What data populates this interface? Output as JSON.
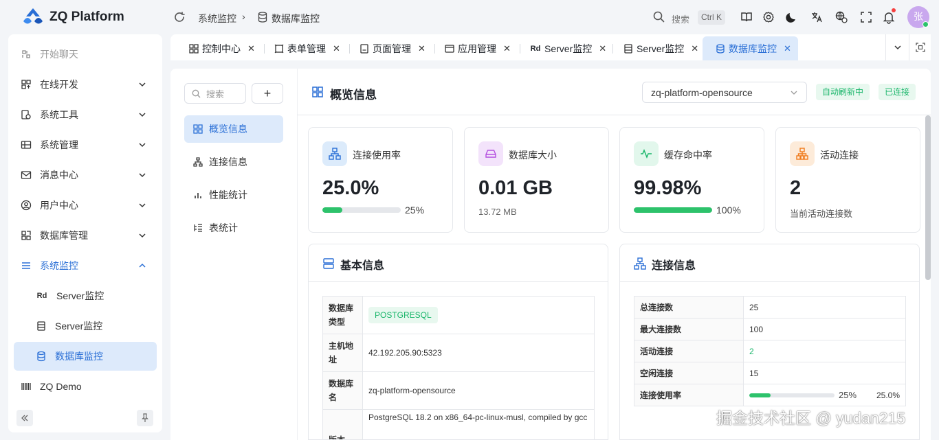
{
  "app": {
    "title": "ZQ Platform",
    "brand_color": "#2a6fd6"
  },
  "breadcrumb": {
    "parent": "系统监控",
    "current": "数据库监控"
  },
  "header": {
    "search_label": "搜索",
    "search_shortcut": "Ctrl K",
    "avatar_text": "张",
    "icons": [
      "book-icon",
      "settings-icon",
      "dark-mode-icon",
      "translate-icon",
      "language-icon",
      "fullscreen-icon",
      "bell-icon"
    ]
  },
  "sidebar": {
    "items": [
      {
        "label": "开始聊天",
        "icon": "chat-icon"
      },
      {
        "label": "在线开发",
        "icon": "dev-icon"
      },
      {
        "label": "系统工具",
        "icon": "tools-icon"
      },
      {
        "label": "系统管理",
        "icon": "manage-icon"
      },
      {
        "label": "消息中心",
        "icon": "mail-icon"
      },
      {
        "label": "用户中心",
        "icon": "user-icon"
      },
      {
        "label": "数据库管理",
        "icon": "db-manage-icon"
      },
      {
        "label": "系统监控",
        "icon": "monitor-icon"
      }
    ],
    "sub_items": [
      {
        "label": "Server监控",
        "prefix": "Rd"
      },
      {
        "label": "Server监控"
      },
      {
        "label": "数据库监控"
      }
    ],
    "demo": "ZQ Demo"
  },
  "tabs": [
    {
      "label": "控制中心"
    },
    {
      "label": "表单管理"
    },
    {
      "label": "页面管理"
    },
    {
      "label": "应用管理"
    },
    {
      "label": "Server监控",
      "prefix": "Rd"
    },
    {
      "label": "Server监控"
    },
    {
      "label": "数据库监控"
    }
  ],
  "db_menu": {
    "search_placeholder": "搜索",
    "add_label": "+",
    "items": [
      "概览信息",
      "连接信息",
      "性能统计",
      "表统计"
    ]
  },
  "overview": {
    "title": "概览信息",
    "selected_db": "zq-platform-opensource",
    "auto_refresh": "自动刷新中",
    "connected": "已连接"
  },
  "stats": [
    {
      "label": "连接使用率",
      "value": "25.0%",
      "progress": 25,
      "pct_text": "25%"
    },
    {
      "label": "数据库大小",
      "value": "0.01 GB",
      "sub": "13.72 MB"
    },
    {
      "label": "缓存命中率",
      "value": "99.98%",
      "progress": 99.98,
      "pct_text": "100%"
    },
    {
      "label": "活动连接",
      "value": "2",
      "sub": "当前活动连接数"
    }
  ],
  "basic_info": {
    "title": "基本信息",
    "rows": [
      {
        "key": "数据库类型",
        "value": "POSTGRESQL"
      },
      {
        "key": "主机地址",
        "value": "42.192.205.90:5323"
      },
      {
        "key": "数据库名",
        "value": "zq-platform-opensource"
      },
      {
        "key": "版本",
        "value": "PostgreSQL 18.2 on x86_64-pc-linux-musl, compiled by gcc"
      }
    ]
  },
  "conn_info": {
    "title": "连接信息",
    "rows": [
      {
        "key": "总连接数",
        "value": "25"
      },
      {
        "key": "最大连接数",
        "value": "100"
      },
      {
        "key": "活动连接",
        "value": "2"
      },
      {
        "key": "空闲连接",
        "value": "15"
      },
      {
        "key": "连接使用率",
        "value": "25.0%",
        "progress": 25,
        "pct_text": "25%"
      }
    ]
  },
  "watermark": "掘金技术社区 @ yudan215"
}
